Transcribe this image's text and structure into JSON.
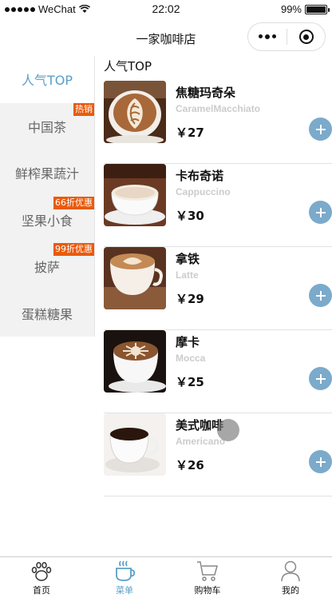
{
  "status_bar": {
    "carrier": "WeChat",
    "time": "22:02",
    "battery": "99%",
    "battery_level": 0.99
  },
  "nav": {
    "title": "一家咖啡店"
  },
  "sidebar": {
    "items": [
      {
        "label": "人气TOP",
        "badge": ""
      },
      {
        "label": "中国茶",
        "badge": "热销"
      },
      {
        "label": "鲜榨果蔬汁",
        "badge": ""
      },
      {
        "label": "坚果小食",
        "badge": "66折优惠"
      },
      {
        "label": "披萨",
        "badge": "99折优惠"
      },
      {
        "label": "蛋糕糖果",
        "badge": ""
      }
    ]
  },
  "main": {
    "section_title": "人气TOP",
    "products": [
      {
        "name": "焦糖玛奇朵",
        "en": "CaramelMacchiato",
        "price": "￥27",
        "image_icon": "latte-art-cup"
      },
      {
        "name": "卡布奇诺",
        "en": "Cappuccino",
        "price": "￥30",
        "image_icon": "cappuccino-cup"
      },
      {
        "name": "拿铁",
        "en": "Latte",
        "price": "￥29",
        "image_icon": "latte-cup"
      },
      {
        "name": "摩卡",
        "en": "Mocca",
        "price": "￥25",
        "image_icon": "mocha-cup"
      },
      {
        "name": "美式咖啡",
        "en": "Americano",
        "price": "￥26",
        "image_icon": "americano-cup"
      }
    ]
  },
  "tabbar": {
    "items": [
      {
        "label": "首页",
        "icon": "paw-icon"
      },
      {
        "label": "菜单",
        "icon": "coffee-cup-icon"
      },
      {
        "label": "购物车",
        "icon": "cart-icon"
      },
      {
        "label": "我的",
        "icon": "person-icon"
      }
    ]
  },
  "colors": {
    "accent": "#5aa0c8",
    "add_button": "#7baacb",
    "badge": "#e95a0c"
  }
}
